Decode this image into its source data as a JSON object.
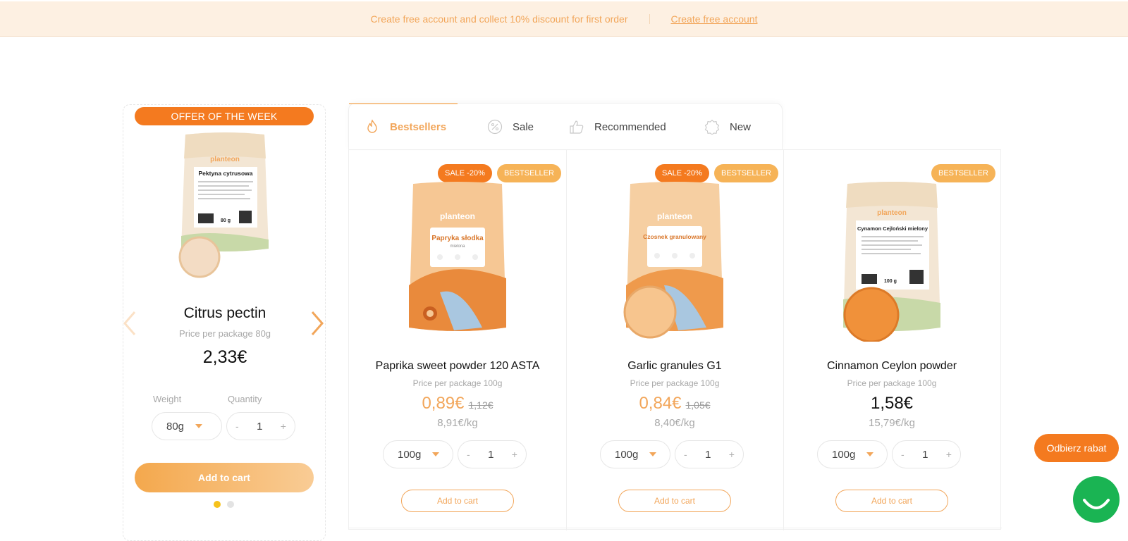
{
  "topbar": {
    "message": "Create free account and collect 10% discount for first order",
    "link": "Create free account"
  },
  "offer": {
    "badge": "OFFER OF THE WEEK",
    "name": "Citrus pectin",
    "price_per": "Price per package 80g",
    "price": "2,33€",
    "weight_label": "Weight",
    "quantity_label": "Quantity",
    "weight_value": "80g",
    "quantity_value": "1",
    "minus": "-",
    "plus": "+",
    "add_to_cart": "Add to cart",
    "pack_brand": "planteon",
    "pack_title": "Pektyna cytrusowa",
    "pack_weight": "80 g",
    "slides_total": 2,
    "slide_active": 1
  },
  "tabs": [
    {
      "label": "Bestsellers",
      "icon": "flame-icon",
      "active": true
    },
    {
      "label": "Sale",
      "icon": "percent-icon",
      "active": false
    },
    {
      "label": "Recommended",
      "icon": "thumbs-up-icon",
      "active": false
    },
    {
      "label": "New",
      "icon": "new-badge-icon",
      "active": false
    }
  ],
  "products": [
    {
      "badges": [
        "SALE -20%",
        "BESTSELLER"
      ],
      "name": "Paprika sweet powder 120 ASTA",
      "price_per": "Price per package 100g",
      "price": "0,89€",
      "old_price": "1,12€",
      "per_kg": "8,91€/kg",
      "weight": "100g",
      "qty": "1",
      "minus": "-",
      "plus": "+",
      "add_to_cart": "Add to cart",
      "pack_brand": "planteon",
      "pack_title": "Papryka słodka",
      "pack_subtitle": "mielona",
      "powder_color": "#e88f3c"
    },
    {
      "badges": [
        "SALE -20%",
        "BESTSELLER"
      ],
      "name": "Garlic granules G1",
      "price_per": "Price per package 100g",
      "price": "0,84€",
      "old_price": "1,05€",
      "per_kg": "8,40€/kg",
      "weight": "100g",
      "qty": "1",
      "minus": "-",
      "plus": "+",
      "add_to_cart": "Add to cart",
      "pack_brand": "planteon",
      "pack_title": "Czosnek granulowany",
      "powder_color": "#f7c58e"
    },
    {
      "badges": [
        "BESTSELLER"
      ],
      "name": "Cinnamon Ceylon powder",
      "price_per": "Price per package 100g",
      "price": "1,58€",
      "old_price": "",
      "per_kg": "15,79€/kg",
      "weight": "100g",
      "qty": "1",
      "minus": "-",
      "plus": "+",
      "add_to_cart": "Add to cart",
      "pack_brand": "planteon",
      "pack_title": "Cynamon Cejloński mielony",
      "pack_weight": "100 g",
      "powder_color": "#f0913a"
    }
  ],
  "floating": {
    "rabat": "Odbierz rabat",
    "chat_icon": "chat-icon"
  },
  "colors": {
    "accent": "#f2a65a",
    "sale": "#f47a1f",
    "bestseller": "#f6b357",
    "chat": "#1ab453"
  }
}
